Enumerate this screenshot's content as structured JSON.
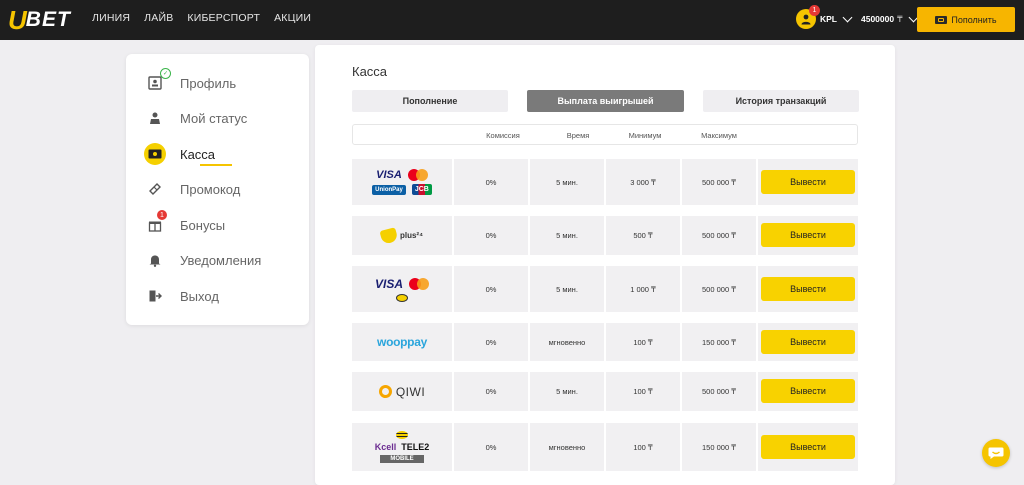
{
  "header": {
    "logo_first": "U",
    "logo_rest": "BET",
    "nav": [
      "ЛИНИЯ",
      "ЛАЙВ",
      "КИБЕРСПОРТ",
      "АКЦИИ"
    ],
    "notifications": "1",
    "username": "KPL",
    "balance": "4500000",
    "currency": "₸",
    "deposit_label": "Пополнить"
  },
  "sidebar": {
    "items": [
      {
        "label": "Профиль",
        "icon": "profile-card-icon"
      },
      {
        "label": "Мой статус",
        "icon": "user-status-icon"
      },
      {
        "label": "Касса",
        "icon": "cash-icon"
      },
      {
        "label": "Промокод",
        "icon": "ticket-icon"
      },
      {
        "label": "Бонусы",
        "icon": "gift-icon",
        "badge": "1"
      },
      {
        "label": "Уведомления",
        "icon": "bell-icon"
      },
      {
        "label": "Выход",
        "icon": "logout-icon"
      }
    ],
    "active": "Касса"
  },
  "main": {
    "title": "Касса",
    "tabs": [
      "Пополнение",
      "Выплата выигрышей",
      "История транзакций"
    ],
    "active_tab": "Выплата выигрышей",
    "columns": [
      "Комиссия",
      "Время",
      "Минимум",
      "Максимум"
    ],
    "action_label": "Вывести",
    "rows": [
      {
        "method": "Visa / Mastercard / UnionPay / JCB",
        "fee": "0%",
        "time": "5 мин.",
        "min": "3 000 ₸",
        "max": "500 000 ₸"
      },
      {
        "method": "plus24",
        "fee": "0%",
        "time": "5 мин.",
        "min": "500 ₸",
        "max": "500 000 ₸"
      },
      {
        "method": "Visa / Mastercard / Beeline",
        "fee": "0%",
        "time": "5 мин.",
        "min": "1 000 ₸",
        "max": "500 000 ₸"
      },
      {
        "method": "wooppay",
        "fee": "0%",
        "time": "мгновенно",
        "min": "100 ₸",
        "max": "150 000 ₸"
      },
      {
        "method": "QIWI",
        "fee": "0%",
        "time": "5 мин.",
        "min": "100 ₸",
        "max": "500 000 ₸"
      },
      {
        "method": "Kcell / TELE2 / Beeline",
        "fee": "0%",
        "time": "мгновенно",
        "min": "100 ₸",
        "max": "150 000 ₸"
      }
    ],
    "logos": {
      "visa": "VISA",
      "plus24": "plus²⁴",
      "wooppay": "wooppay",
      "qiwi": "QIWI",
      "kcell": "Kcell",
      "tele2": "TELE2",
      "mobile": "MOBILE",
      "jcb": "JCB",
      "unionpay": "UnionPay"
    }
  },
  "colors": {
    "accent": "#f5c400",
    "header_bg": "#1e1e1e",
    "button": "#f8d200"
  }
}
